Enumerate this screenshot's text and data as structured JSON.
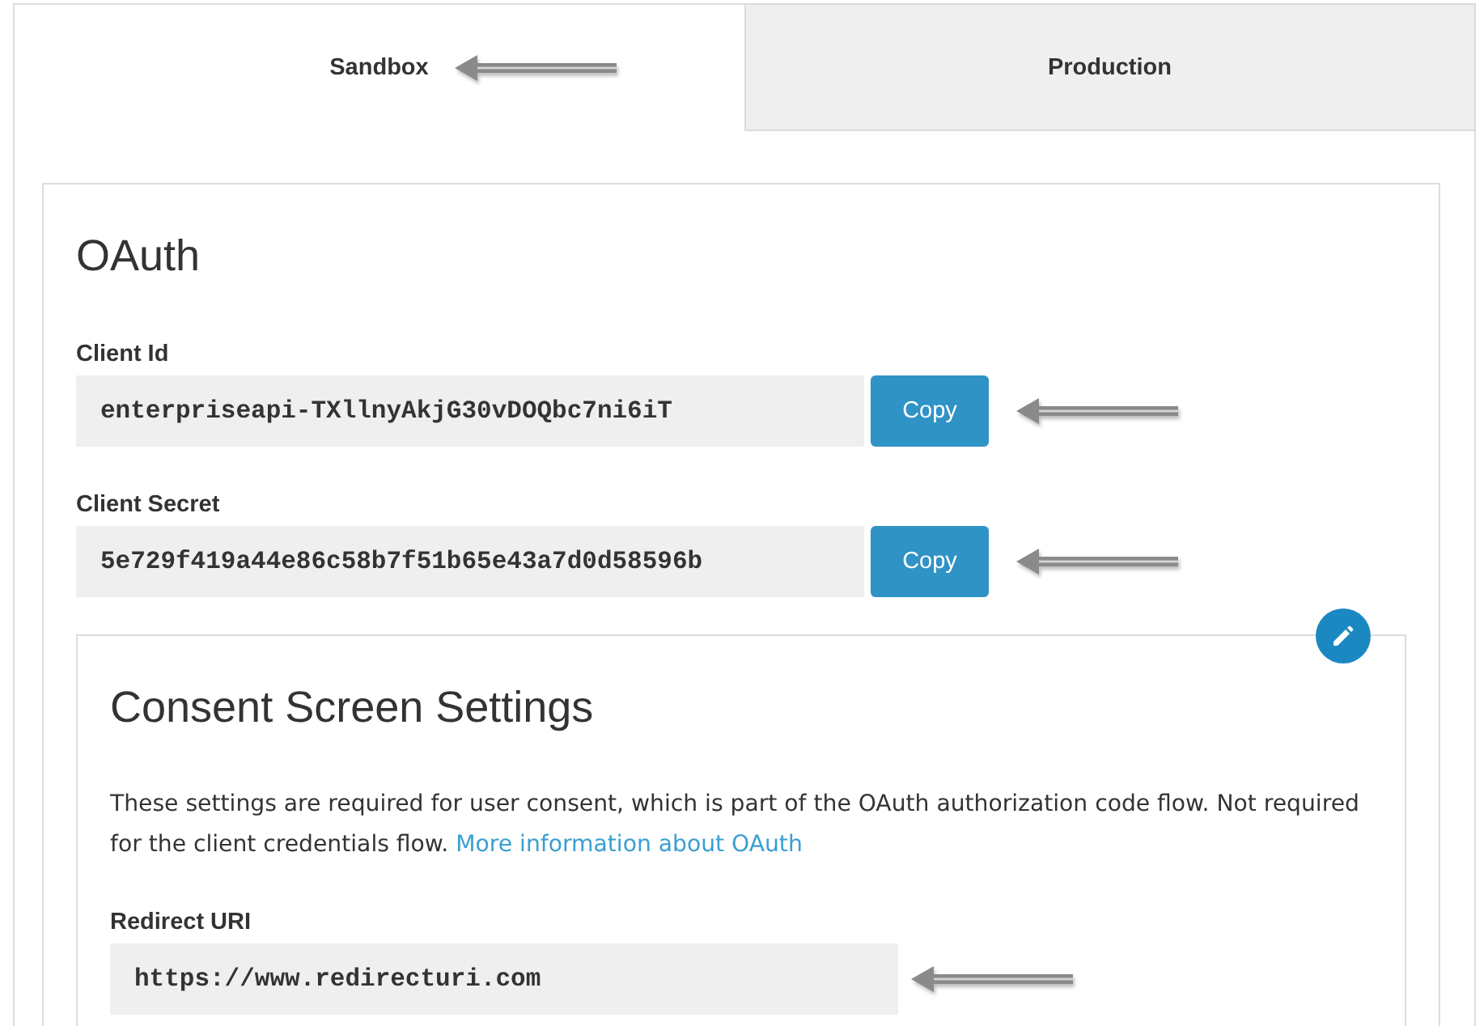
{
  "tabs": [
    {
      "label": "Sandbox",
      "selected": true,
      "annotated": true
    },
    {
      "label": "Production",
      "selected": false,
      "annotated": false
    }
  ],
  "oauth": {
    "title": "OAuth",
    "fields": [
      {
        "label": "Client Id",
        "value": "enterpriseapi-TXllnyAkjG30vDOQbc7ni6iT",
        "button": "Copy",
        "annotated": true
      },
      {
        "label": "Client Secret",
        "value": "5e729f419a44e86c58b7f51b65e43a7d0d58596b",
        "button": "Copy",
        "annotated": true
      }
    ]
  },
  "consent": {
    "title": "Consent Screen Settings",
    "description": "These settings are required for user consent, which is part of the OAuth authorization code flow. Not required for the client credentials flow.",
    "link": "More information about OAuth",
    "fields": [
      {
        "label": "Redirect URI",
        "value": "https://www.redirecturi.com",
        "annotated": true
      }
    ]
  }
}
